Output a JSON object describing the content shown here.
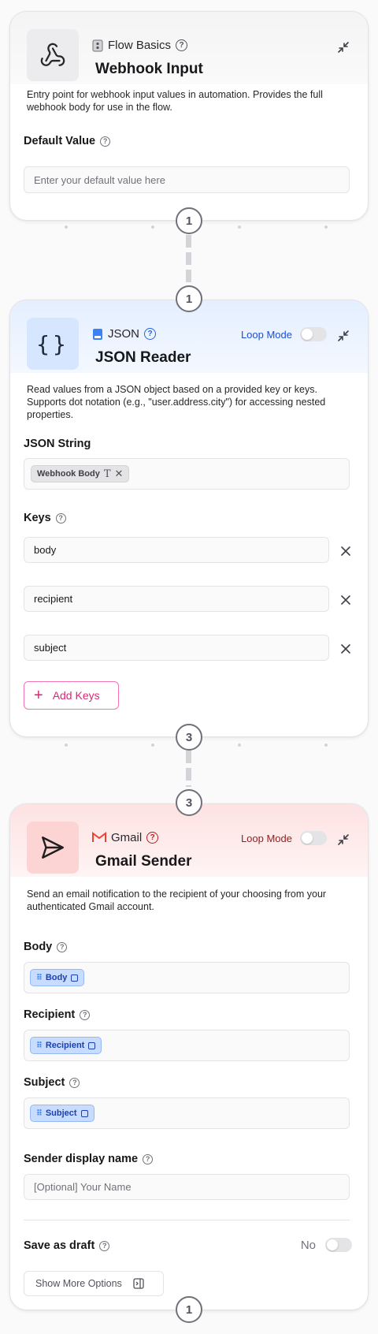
{
  "colors": {
    "accent_blue": "#2563eb",
    "accent_red": "#b91c1c",
    "accent_pink": "#db2777",
    "border": "#e4e4e7"
  },
  "card1": {
    "category": "Flow Basics",
    "title": "Webhook Input",
    "icon": "webhook-icon",
    "description": "Entry point for webhook input values in automation. Provides the full webhook body for use in the flow.",
    "default_value_label": "Default Value",
    "default_value_placeholder": "Enter your default value here",
    "step_out": "1"
  },
  "card2": {
    "step_in": "1",
    "category": "JSON",
    "title": "JSON Reader",
    "icon": "braces-icon",
    "loop_mode_label": "Loop Mode",
    "description": "Read values from a JSON object based on a provided key or keys. Supports dot notation (e.g., \"user.address.city\") for accessing nested properties.",
    "json_string_label": "JSON String",
    "json_string_chip": "Webhook Body",
    "keys_label": "Keys",
    "keys": [
      "body",
      "recipient",
      "subject"
    ],
    "add_keys_label": "Add Keys",
    "step_out": "3"
  },
  "card3": {
    "step_in": "3",
    "category": "Gmail",
    "title": "Gmail Sender",
    "icon": "send-icon",
    "loop_mode_label": "Loop Mode",
    "description": "Send an email notification to the recipient of your choosing from your authenticated Gmail account.",
    "body_label": "Body",
    "body_chip": "Body",
    "recipient_label": "Recipient",
    "recipient_chip": "Recipient",
    "subject_label": "Subject",
    "subject_chip": "Subject",
    "sender_label": "Sender display name",
    "sender_placeholder": "[Optional] Your Name",
    "draft_label": "Save as draft",
    "draft_value": "No",
    "more_options_label": "Show More Options",
    "step_out": "1"
  }
}
